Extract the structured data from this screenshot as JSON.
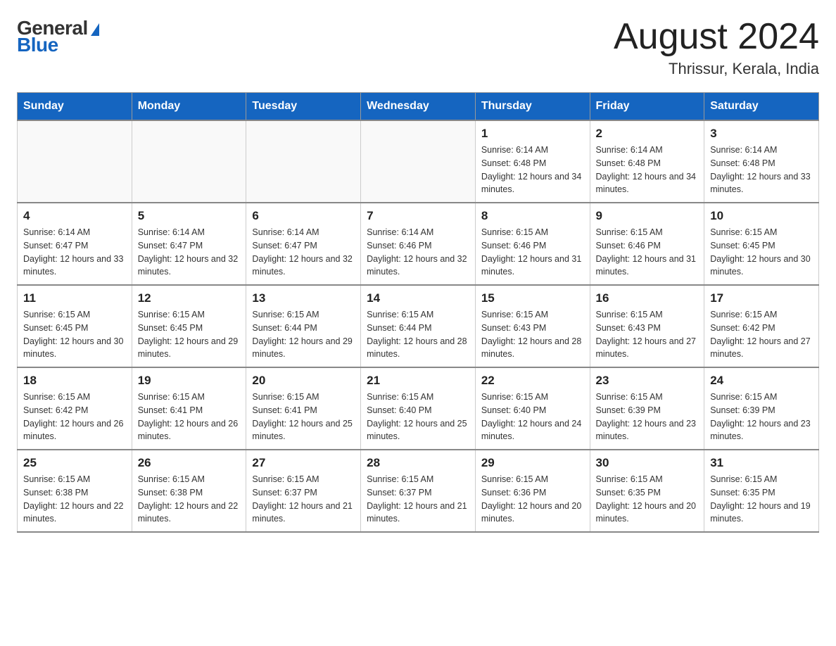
{
  "header": {
    "logo_general": "General",
    "logo_blue": "Blue",
    "month_title": "August 2024",
    "location": "Thrissur, Kerala, India"
  },
  "weekdays": [
    "Sunday",
    "Monday",
    "Tuesday",
    "Wednesday",
    "Thursday",
    "Friday",
    "Saturday"
  ],
  "weeks": [
    [
      {
        "day": "",
        "sunrise": "",
        "sunset": "",
        "daylight": ""
      },
      {
        "day": "",
        "sunrise": "",
        "sunset": "",
        "daylight": ""
      },
      {
        "day": "",
        "sunrise": "",
        "sunset": "",
        "daylight": ""
      },
      {
        "day": "",
        "sunrise": "",
        "sunset": "",
        "daylight": ""
      },
      {
        "day": "1",
        "sunrise": "Sunrise: 6:14 AM",
        "sunset": "Sunset: 6:48 PM",
        "daylight": "Daylight: 12 hours and 34 minutes."
      },
      {
        "day": "2",
        "sunrise": "Sunrise: 6:14 AM",
        "sunset": "Sunset: 6:48 PM",
        "daylight": "Daylight: 12 hours and 34 minutes."
      },
      {
        "day": "3",
        "sunrise": "Sunrise: 6:14 AM",
        "sunset": "Sunset: 6:48 PM",
        "daylight": "Daylight: 12 hours and 33 minutes."
      }
    ],
    [
      {
        "day": "4",
        "sunrise": "Sunrise: 6:14 AM",
        "sunset": "Sunset: 6:47 PM",
        "daylight": "Daylight: 12 hours and 33 minutes."
      },
      {
        "day": "5",
        "sunrise": "Sunrise: 6:14 AM",
        "sunset": "Sunset: 6:47 PM",
        "daylight": "Daylight: 12 hours and 32 minutes."
      },
      {
        "day": "6",
        "sunrise": "Sunrise: 6:14 AM",
        "sunset": "Sunset: 6:47 PM",
        "daylight": "Daylight: 12 hours and 32 minutes."
      },
      {
        "day": "7",
        "sunrise": "Sunrise: 6:14 AM",
        "sunset": "Sunset: 6:46 PM",
        "daylight": "Daylight: 12 hours and 32 minutes."
      },
      {
        "day": "8",
        "sunrise": "Sunrise: 6:15 AM",
        "sunset": "Sunset: 6:46 PM",
        "daylight": "Daylight: 12 hours and 31 minutes."
      },
      {
        "day": "9",
        "sunrise": "Sunrise: 6:15 AM",
        "sunset": "Sunset: 6:46 PM",
        "daylight": "Daylight: 12 hours and 31 minutes."
      },
      {
        "day": "10",
        "sunrise": "Sunrise: 6:15 AM",
        "sunset": "Sunset: 6:45 PM",
        "daylight": "Daylight: 12 hours and 30 minutes."
      }
    ],
    [
      {
        "day": "11",
        "sunrise": "Sunrise: 6:15 AM",
        "sunset": "Sunset: 6:45 PM",
        "daylight": "Daylight: 12 hours and 30 minutes."
      },
      {
        "day": "12",
        "sunrise": "Sunrise: 6:15 AM",
        "sunset": "Sunset: 6:45 PM",
        "daylight": "Daylight: 12 hours and 29 minutes."
      },
      {
        "day": "13",
        "sunrise": "Sunrise: 6:15 AM",
        "sunset": "Sunset: 6:44 PM",
        "daylight": "Daylight: 12 hours and 29 minutes."
      },
      {
        "day": "14",
        "sunrise": "Sunrise: 6:15 AM",
        "sunset": "Sunset: 6:44 PM",
        "daylight": "Daylight: 12 hours and 28 minutes."
      },
      {
        "day": "15",
        "sunrise": "Sunrise: 6:15 AM",
        "sunset": "Sunset: 6:43 PM",
        "daylight": "Daylight: 12 hours and 28 minutes."
      },
      {
        "day": "16",
        "sunrise": "Sunrise: 6:15 AM",
        "sunset": "Sunset: 6:43 PM",
        "daylight": "Daylight: 12 hours and 27 minutes."
      },
      {
        "day": "17",
        "sunrise": "Sunrise: 6:15 AM",
        "sunset": "Sunset: 6:42 PM",
        "daylight": "Daylight: 12 hours and 27 minutes."
      }
    ],
    [
      {
        "day": "18",
        "sunrise": "Sunrise: 6:15 AM",
        "sunset": "Sunset: 6:42 PM",
        "daylight": "Daylight: 12 hours and 26 minutes."
      },
      {
        "day": "19",
        "sunrise": "Sunrise: 6:15 AM",
        "sunset": "Sunset: 6:41 PM",
        "daylight": "Daylight: 12 hours and 26 minutes."
      },
      {
        "day": "20",
        "sunrise": "Sunrise: 6:15 AM",
        "sunset": "Sunset: 6:41 PM",
        "daylight": "Daylight: 12 hours and 25 minutes."
      },
      {
        "day": "21",
        "sunrise": "Sunrise: 6:15 AM",
        "sunset": "Sunset: 6:40 PM",
        "daylight": "Daylight: 12 hours and 25 minutes."
      },
      {
        "day": "22",
        "sunrise": "Sunrise: 6:15 AM",
        "sunset": "Sunset: 6:40 PM",
        "daylight": "Daylight: 12 hours and 24 minutes."
      },
      {
        "day": "23",
        "sunrise": "Sunrise: 6:15 AM",
        "sunset": "Sunset: 6:39 PM",
        "daylight": "Daylight: 12 hours and 23 minutes."
      },
      {
        "day": "24",
        "sunrise": "Sunrise: 6:15 AM",
        "sunset": "Sunset: 6:39 PM",
        "daylight": "Daylight: 12 hours and 23 minutes."
      }
    ],
    [
      {
        "day": "25",
        "sunrise": "Sunrise: 6:15 AM",
        "sunset": "Sunset: 6:38 PM",
        "daylight": "Daylight: 12 hours and 22 minutes."
      },
      {
        "day": "26",
        "sunrise": "Sunrise: 6:15 AM",
        "sunset": "Sunset: 6:38 PM",
        "daylight": "Daylight: 12 hours and 22 minutes."
      },
      {
        "day": "27",
        "sunrise": "Sunrise: 6:15 AM",
        "sunset": "Sunset: 6:37 PM",
        "daylight": "Daylight: 12 hours and 21 minutes."
      },
      {
        "day": "28",
        "sunrise": "Sunrise: 6:15 AM",
        "sunset": "Sunset: 6:37 PM",
        "daylight": "Daylight: 12 hours and 21 minutes."
      },
      {
        "day": "29",
        "sunrise": "Sunrise: 6:15 AM",
        "sunset": "Sunset: 6:36 PM",
        "daylight": "Daylight: 12 hours and 20 minutes."
      },
      {
        "day": "30",
        "sunrise": "Sunrise: 6:15 AM",
        "sunset": "Sunset: 6:35 PM",
        "daylight": "Daylight: 12 hours and 20 minutes."
      },
      {
        "day": "31",
        "sunrise": "Sunrise: 6:15 AM",
        "sunset": "Sunset: 6:35 PM",
        "daylight": "Daylight: 12 hours and 19 minutes."
      }
    ]
  ]
}
